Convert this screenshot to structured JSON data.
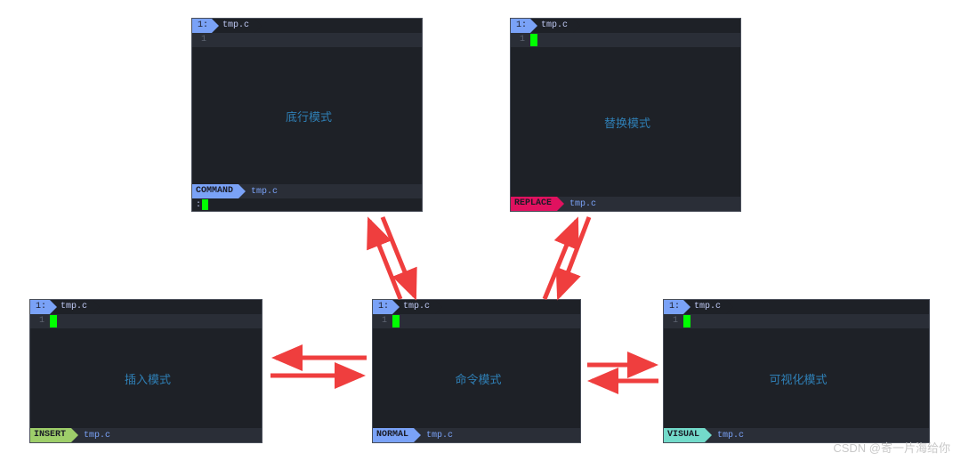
{
  "diagram": {
    "windows": {
      "command_mode": {
        "tab_num": "1:",
        "tab_file": "tmp.c",
        "line_num": "1",
        "label": "底行模式",
        "mode_badge": "COMMAND",
        "status_file": "tmp.c",
        "cmdline_prefix": ":"
      },
      "replace_mode": {
        "tab_num": "1:",
        "tab_file": "tmp.c",
        "line_num": "1",
        "label": "替换模式",
        "mode_badge": "REPLACE",
        "status_file": "tmp.c"
      },
      "insert_mode": {
        "tab_num": "1:",
        "tab_file": "tmp.c",
        "line_num": "1",
        "label": "插入模式",
        "mode_badge": "INSERT",
        "status_file": "tmp.c"
      },
      "normal_mode": {
        "tab_num": "1:",
        "tab_file": "tmp.c",
        "line_num": "1",
        "label": "命令模式",
        "mode_badge": "NORMAL",
        "status_file": "tmp.c"
      },
      "visual_mode": {
        "tab_num": "1:",
        "tab_file": "tmp.c",
        "line_num": "1",
        "label": "可视化模式",
        "mode_badge": "VISUAL",
        "status_file": "tmp.c"
      }
    },
    "arrow_color": "#ef3e3e"
  },
  "watermark": "CSDN @寄一片海给你"
}
